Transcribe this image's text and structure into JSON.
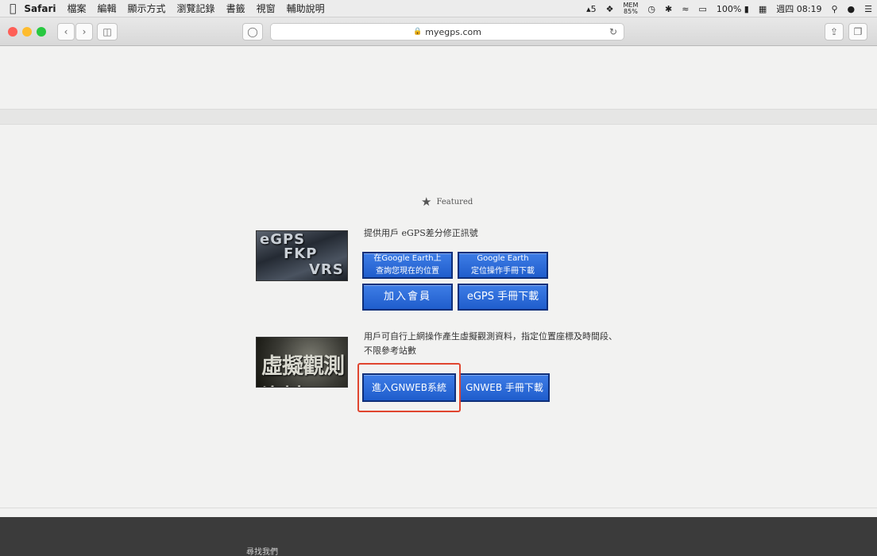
{
  "menubar": {
    "apple": "",
    "items": [
      "Safari",
      "檔案",
      "編輯",
      "顯示方式",
      "瀏覽記錄",
      "書籤",
      "視窗",
      "輔助說明"
    ],
    "status": {
      "adobe": "5",
      "mem_label": "MEM",
      "mem_value": "85%",
      "battery": "100%",
      "time": "週四 08:19"
    }
  },
  "browser": {
    "url": "myegps.com",
    "colors": {
      "close": "#fe5f57",
      "minimize": "#febc2e",
      "zoom": "#28c840"
    }
  },
  "featured": {
    "label": "Featured"
  },
  "section1": {
    "thumb_text": [
      "eGPS",
      "FKP",
      "VRS"
    ],
    "description": "提供用戶 eGPS差分修正訊號",
    "btn_google_earth_query": [
      "在Google Earth上",
      "查詢您現在的位置"
    ],
    "btn_google_earth_manual": [
      "Google Earth",
      "定位操作手冊下載"
    ],
    "btn_join": "加入會員",
    "btn_egps_manual": "eGPS 手冊下載"
  },
  "section2": {
    "thumb_text": "虛擬觀測資料",
    "description_line1": "用戶可自行上網操作產生虛擬觀測資料，指定位置座標及時間段、",
    "description_line2": "不限參考站數",
    "btn_enter_gnweb": "進入GNWEB系統",
    "btn_gnweb_manual": "GNWEB 手冊下載"
  },
  "footer": {
    "title": "尋找我們"
  }
}
